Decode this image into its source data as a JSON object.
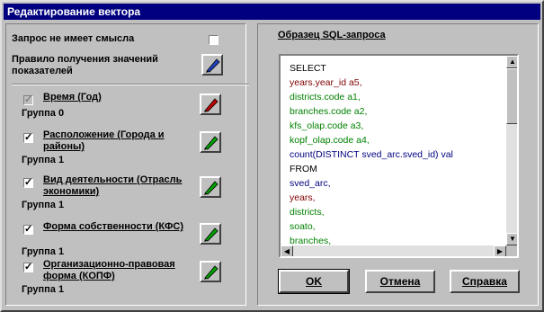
{
  "window": {
    "title": "Редактирование вектора"
  },
  "left": {
    "meaningless_label": "Запрос не имеет смысла",
    "rule_label": "Правило получения значений показателей",
    "dimensions": [
      {
        "name": "Время (Год)",
        "group": "Группа 0",
        "checked": true,
        "enabled": false,
        "pen": "red"
      },
      {
        "name": "Расположение (Города и районы)",
        "group": "Группа 1",
        "checked": true,
        "enabled": true,
        "pen": "green"
      },
      {
        "name": "Вид деятельности (Отрасль экономики)",
        "group": "Группа 1",
        "checked": true,
        "enabled": true,
        "pen": "green"
      },
      {
        "name": "Форма собственности (КФС)",
        "group": "Группа 1",
        "checked": true,
        "enabled": true,
        "pen": "green"
      },
      {
        "name": "Организационно-правовая форма (КОПФ)",
        "group": "Группа 1",
        "checked": true,
        "enabled": true,
        "pen": "green"
      }
    ]
  },
  "right": {
    "sql_title": "Образец SQL-запроса",
    "sql_lines": [
      {
        "text": "SELECT",
        "color": "#000000"
      },
      {
        "text": "years.year_id a5,",
        "color": "#800000"
      },
      {
        "text": "districts.code a1,",
        "color": "#008000"
      },
      {
        "text": "branches.code a2,",
        "color": "#008000"
      },
      {
        "text": "kfs_olap.code a3,",
        "color": "#008000"
      },
      {
        "text": "kopf_olap.code a4,",
        "color": "#008000"
      },
      {
        "text": "count(DISTINCT sved_arc.sved_id) val",
        "color": "#000080"
      },
      {
        "text": "FROM",
        "color": "#000000"
      },
      {
        "text": "sved_arc,",
        "color": "#000080"
      },
      {
        "text": "years,",
        "color": "#800000"
      },
      {
        "text": "districts,",
        "color": "#008000"
      },
      {
        "text": "soato,",
        "color": "#008000"
      },
      {
        "text": "branches,",
        "color": "#008000"
      }
    ]
  },
  "buttons": {
    "ok": "OK",
    "cancel": "Отмена",
    "help": "Справка"
  }
}
